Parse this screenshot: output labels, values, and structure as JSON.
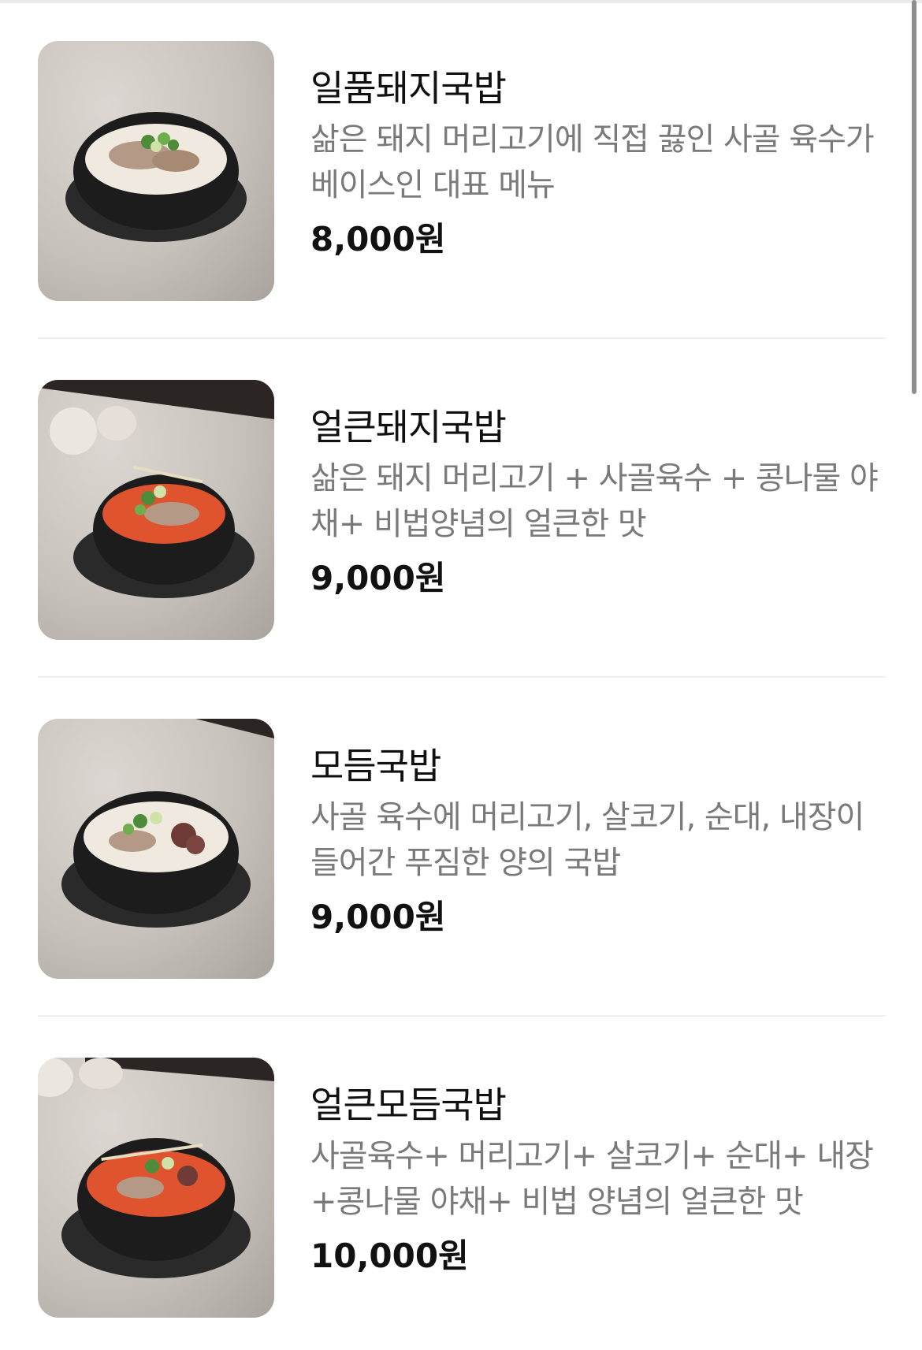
{
  "menu": {
    "items": [
      {
        "name": "일품돼지국밥",
        "description": "삶은 돼지 머리고기에 직접 끓인 사골 육수가 베이스인 대표 메뉴",
        "price": "8,000원",
        "photo": {
          "broth_color": "#efe9df",
          "style": "clear"
        }
      },
      {
        "name": "얼큰돼지국밥",
        "description": "삶은 돼지 머리고기 + 사골육수 + 콩나물 야채+ 비법양념의 얼큰한 맛",
        "price": "9,000원",
        "photo": {
          "broth_color": "#e0532f",
          "style": "spicy"
        }
      },
      {
        "name": "모듬국밥",
        "description": "사골 육수에 머리고기, 살코기, 순대, 내장이 들어간 푸짐한 양의 국밥",
        "price": "9,000원",
        "photo": {
          "broth_color": "#efe9df",
          "style": "clear"
        }
      },
      {
        "name": "얼큰모듬국밥",
        "description": "사골육수+ 머리고기+ 살코기+ 순대+ 내장+콩나물 야채+ 비법 양념의 얼큰한 맛",
        "price": "10,000원",
        "photo": {
          "broth_color": "#e0532f",
          "style": "spicy"
        }
      }
    ]
  },
  "colors": {
    "background": "#ffffff",
    "divider": "#f0f0f0",
    "title_text": "#111111",
    "description_text": "#7a7a7a",
    "bowl": "#1c1c1c"
  }
}
